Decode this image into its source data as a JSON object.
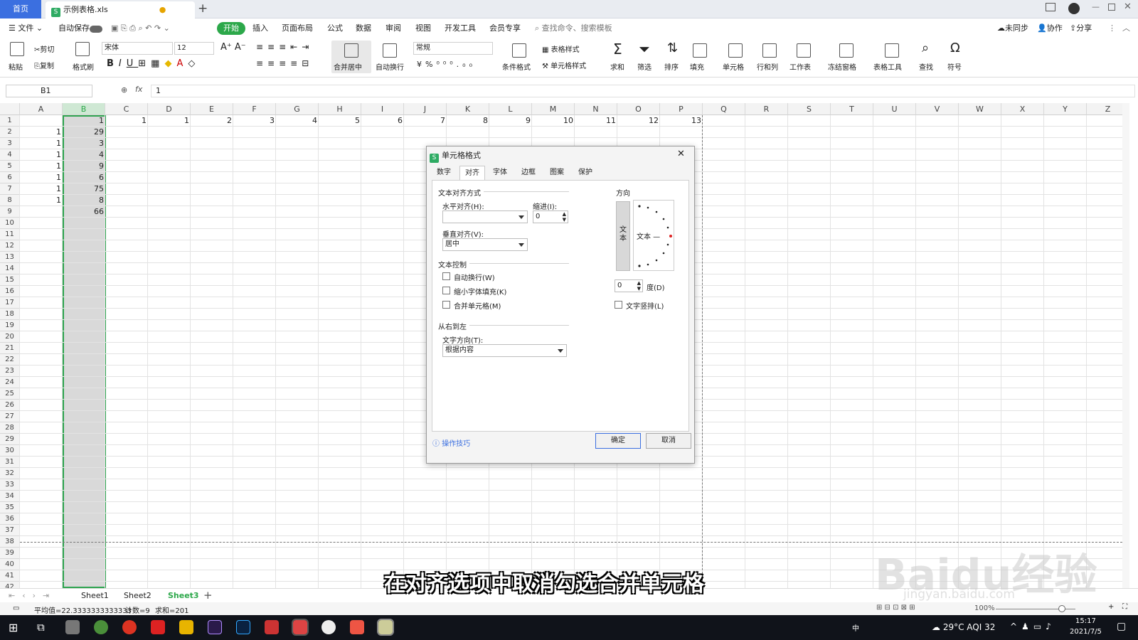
{
  "titlebar": {
    "home_tab": "首页",
    "file_tab": "示例表格.xls"
  },
  "menu": {
    "file": "文件",
    "autosave": "自动保存",
    "items": [
      "开始",
      "插入",
      "页面布局",
      "公式",
      "数据",
      "审阅",
      "视图",
      "开发工具",
      "会员专享"
    ],
    "search": "查找命令、搜索模板",
    "sync": "未同步",
    "collab": "协作",
    "share": "分享"
  },
  "ribbon": {
    "paste": "粘贴",
    "cut": "剪切",
    "copy": "复制",
    "format_painter": "格式刷",
    "font": "宋体",
    "font_size": "12",
    "merge_center": "合并居中",
    "wrap": "自动换行",
    "number_format": "常规",
    "table_style": "表格样式",
    "cond_format": "条件格式",
    "cell_style": "单元格样式",
    "sum": "求和",
    "filter": "筛选",
    "sort": "排序",
    "fill": "填充",
    "cell": "单元格",
    "row_col": "行和列",
    "worksheet": "工作表",
    "freeze": "冻结窗格",
    "table_tools": "表格工具",
    "find": "查找",
    "symbol": "符号"
  },
  "formula": {
    "cell_ref": "B1",
    "fx": "fx",
    "value": "1"
  },
  "grid": {
    "columns": [
      "A",
      "B",
      "C",
      "D",
      "E",
      "F",
      "G",
      "H",
      "I",
      "J",
      "K",
      "L",
      "M",
      "N",
      "O",
      "P",
      "Q",
      "R",
      "S",
      "T",
      "U",
      "V",
      "W",
      "X",
      "Y",
      "Z"
    ],
    "rows": [
      "1",
      "2",
      "3",
      "4",
      "5",
      "6",
      "7",
      "8",
      "9",
      "10",
      "11",
      "12",
      "13",
      "14",
      "15",
      "16",
      "17",
      "18",
      "19",
      "20",
      "21",
      "22",
      "23",
      "24",
      "25",
      "26",
      "27",
      "28",
      "29",
      "30",
      "31",
      "32",
      "33",
      "34",
      "35",
      "36",
      "37",
      "38",
      "39",
      "40",
      "41",
      "42"
    ],
    "colA": [
      "",
      "1",
      "1",
      "1",
      "1",
      "1",
      "1",
      "1"
    ],
    "colB": [
      "1",
      "29",
      "3",
      "4",
      "9",
      "6",
      "75",
      "8",
      "66"
    ],
    "row1_CP": [
      "1",
      "1",
      "2",
      "3",
      "4",
      "5",
      "6",
      "7",
      "8",
      "9",
      "10",
      "11",
      "12",
      "13"
    ]
  },
  "dialog": {
    "title": "单元格格式",
    "tabs": [
      "数字",
      "对齐",
      "字体",
      "边框",
      "图案",
      "保护"
    ],
    "text_align": "文本对齐方式",
    "horizontal": "水平对齐(H):",
    "indent": "缩进(I):",
    "indent_value": "0",
    "vertical": "垂直对齐(V):",
    "vertical_value": "居中",
    "text_control": "文本控制",
    "wrap": "自动换行(W)",
    "shrink": "缩小字体填充(K)",
    "merge": "合并单元格(M)",
    "rtl": "从右到左",
    "direction": "文字方向(T):",
    "direction_value": "根据内容",
    "orientation": "方向",
    "vertical_text": "文本",
    "orient_text": "文本 —",
    "degree_value": "0",
    "degree": "度(D)",
    "vertical_layout": "文字竖排(L)",
    "tips": "操作技巧",
    "ok": "确定",
    "cancel": "取消",
    "wrap_checked": false,
    "shrink_checked": false,
    "merge_checked": false,
    "vertical_layout_checked": false
  },
  "sheets": {
    "tabs": [
      "Sheet1",
      "Sheet2",
      "Sheet3"
    ],
    "active": "Sheet3"
  },
  "status": {
    "avg": "平均值=22.3333333333333",
    "count": "计数=9",
    "sum": "求和=201",
    "zoom": "100%"
  },
  "taskbar": {
    "weather": "29°C AQI 32",
    "time": "15:17",
    "date": "2021/7/5",
    "ime": "中"
  },
  "subtitle": "在对齐选项中取消勾选合并单元格",
  "watermark": {
    "logo": "Baidu经验",
    "url": "jingyan.baidu.com"
  },
  "colors": {
    "accent": "#2ca84a",
    "blue": "#3b6fe0",
    "selection": "#2ea44f"
  }
}
